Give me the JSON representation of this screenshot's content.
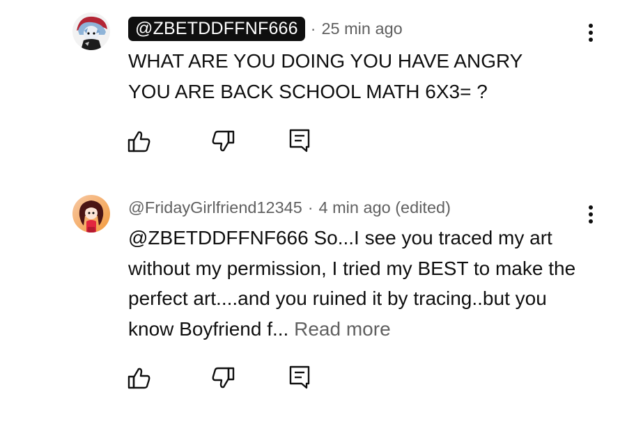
{
  "comments": [
    {
      "author": "@ZBETDDFFNF666",
      "dot": "·",
      "time": "25 min ago",
      "text": "WHAT ARE YOU DOING YOU HAVE ANGRY YOU ARE BACK SCHOOL MATH 6X3= ?",
      "avatar_icon": "character-avatar-icon"
    },
    {
      "author": "@FridayGirlfriend12345",
      "dot": "·",
      "time": "4 min ago (edited)",
      "text": "@ZBETDDFFNF666 So...I see you traced my art without my permission, I tried my BEST to make the perfect art....and you ruined it by tracing..but you know Boyfriend f...",
      "read_more": "Read more",
      "avatar_icon": "girlfriend-avatar-icon"
    }
  ],
  "icons": {
    "like": "thumbs-up-icon",
    "dislike": "thumbs-down-icon",
    "reply": "reply-icon",
    "menu": "more-vertical-icon"
  }
}
